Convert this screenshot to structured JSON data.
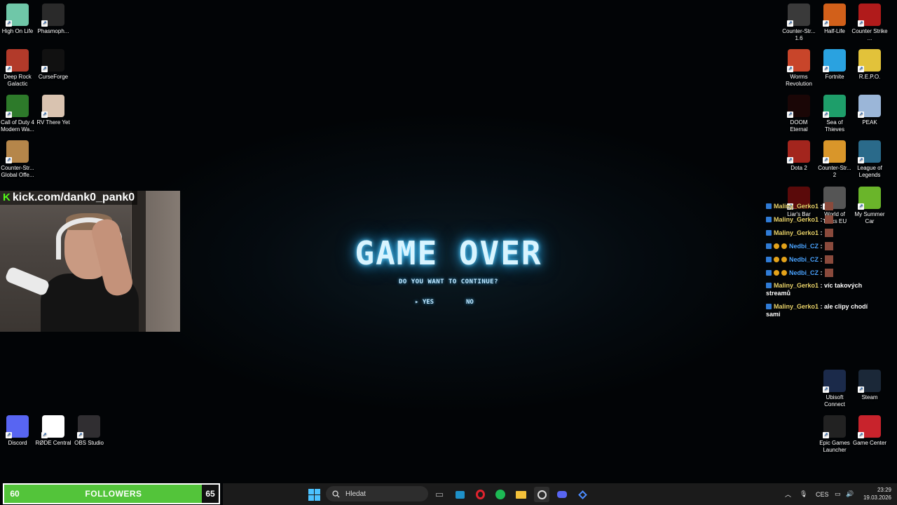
{
  "desktop_left": [
    {
      "label": "High On Life",
      "icon": "high-on-life-icon",
      "color": "#6fc7a8"
    },
    {
      "label": "Phasmoph...",
      "icon": "phasmophobia-icon",
      "color": "#2a2a2a"
    },
    {
      "label": "Deep Rock Galactic",
      "icon": "deep-rock-galactic-icon",
      "color": "#b23a2a"
    },
    {
      "label": "CurseForge",
      "icon": "curseforge-icon",
      "color": "#111111"
    },
    {
      "label": "Call of Duty 4 Modern Wa...",
      "icon": "call-of-duty-icon",
      "color": "#2d7a2a"
    },
    {
      "label": "RV There Yet",
      "icon": "rv-there-yet-icon",
      "color": "#d9c3b0"
    },
    {
      "label": "Counter-Str... Global Offe...",
      "icon": "csgo-icon",
      "color": "#b5864a"
    }
  ],
  "desktop_left_bottom": [
    {
      "label": "Discord",
      "icon": "discord-icon",
      "color": "#5865f2"
    },
    {
      "label": "RØDE Central",
      "icon": "rode-central-icon",
      "color": "#ffffff"
    },
    {
      "label": "OBS Studio",
      "icon": "obs-studio-icon",
      "color": "#302e31"
    }
  ],
  "desktop_right": [
    {
      "label": "Counter-Str... 1.6",
      "icon": "counter-strike-16-icon",
      "color": "#3a3a3a"
    },
    {
      "label": "Half-Life",
      "icon": "half-life-icon",
      "color": "#d2601a"
    },
    {
      "label": "Counter Strike ...",
      "icon": "counter-strike-icon",
      "color": "#b01b1b"
    },
    {
      "label": "Worms Revolution",
      "icon": "worms-revolution-icon",
      "color": "#c8452a"
    },
    {
      "label": "Fortnite",
      "icon": "fortnite-icon",
      "color": "#2aa2e0"
    },
    {
      "label": "R.E.P.O.",
      "icon": "repo-icon",
      "color": "#e2c23a"
    },
    {
      "label": "DOOM Eternal",
      "icon": "doom-eternal-icon",
      "color": "#1a0606"
    },
    {
      "label": "Sea of Thieves",
      "icon": "sea-of-thieves-icon",
      "color": "#1e9e6a"
    },
    {
      "label": "PEAK",
      "icon": "peak-icon",
      "color": "#9bb6d8"
    },
    {
      "label": "Dota 2",
      "icon": "dota2-icon",
      "color": "#a3251d"
    },
    {
      "label": "Counter-Str... 2",
      "icon": "cs2-icon",
      "color": "#d9962a"
    },
    {
      "label": "League of Legends",
      "icon": "league-of-legends-icon",
      "color": "#2a6a8a"
    },
    {
      "label": "Liar's Bar",
      "icon": "liars-bar-icon",
      "color": "#5a0a0a"
    },
    {
      "label": "World of Tanks EU",
      "icon": "world-of-tanks-icon",
      "color": "#555555"
    },
    {
      "label": "My Summer Car",
      "icon": "my-summer-car-icon",
      "color": "#6ab52a"
    }
  ],
  "desktop_right_bottom": [
    {
      "label": "Ubisoft Connect",
      "icon": "ubisoft-connect-icon",
      "color": "#1b2a4a"
    },
    {
      "label": "Steam",
      "icon": "steam-icon",
      "color": "#1b2838"
    },
    {
      "label": "Epic Games Launcher",
      "icon": "epic-games-icon",
      "color": "#222222"
    },
    {
      "label": "Game Center",
      "icon": "game-center-icon",
      "color": "#c8232c"
    }
  ],
  "stream": {
    "url": "kick.com/dank0_pank0"
  },
  "game": {
    "title": "GAME OVER",
    "question": "DO YOU WANT TO CONTINUE?",
    "yes": "▸ YES",
    "no": "NO"
  },
  "chat": [
    {
      "user": "Maliny_Gerko1",
      "msg": ":",
      "color_class": "uname-g",
      "emote": true,
      "badges": 1
    },
    {
      "user": "Maliny_Gerko1",
      "msg": ":",
      "color_class": "uname-g",
      "emote": true,
      "badges": 1
    },
    {
      "user": "Maliny_Gerko1",
      "msg": ":",
      "color_class": "uname-g",
      "emote": true,
      "badges": 1
    },
    {
      "user": "Nedbi_CZ",
      "msg": ":",
      "color_class": "uname-b",
      "emote": true,
      "badges": 3
    },
    {
      "user": "Nedbi_CZ",
      "msg": ":",
      "color_class": "uname-b",
      "emote": true,
      "badges": 3
    },
    {
      "user": "Nedbi_CZ",
      "msg": ":",
      "color_class": "uname-b",
      "emote": true,
      "badges": 3
    },
    {
      "user": "Maliny_Gerko1",
      "msg": ": víc takových streamů",
      "color_class": "uname-g",
      "emote": false,
      "badges": 1
    },
    {
      "user": "Maliny_Gerko1",
      "msg": ": ale clipy chodí sami",
      "color_class": "uname-g",
      "emote": false,
      "badges": 1
    }
  ],
  "followers": {
    "current": "60",
    "label": "FOLLOWERS",
    "target": "65",
    "progress_fraction": 0.923,
    "color": "#53c43a"
  },
  "taskbar": {
    "search_placeholder": "Hledat",
    "language": "CES",
    "time": "23:29",
    "date": "19.03.2026"
  }
}
